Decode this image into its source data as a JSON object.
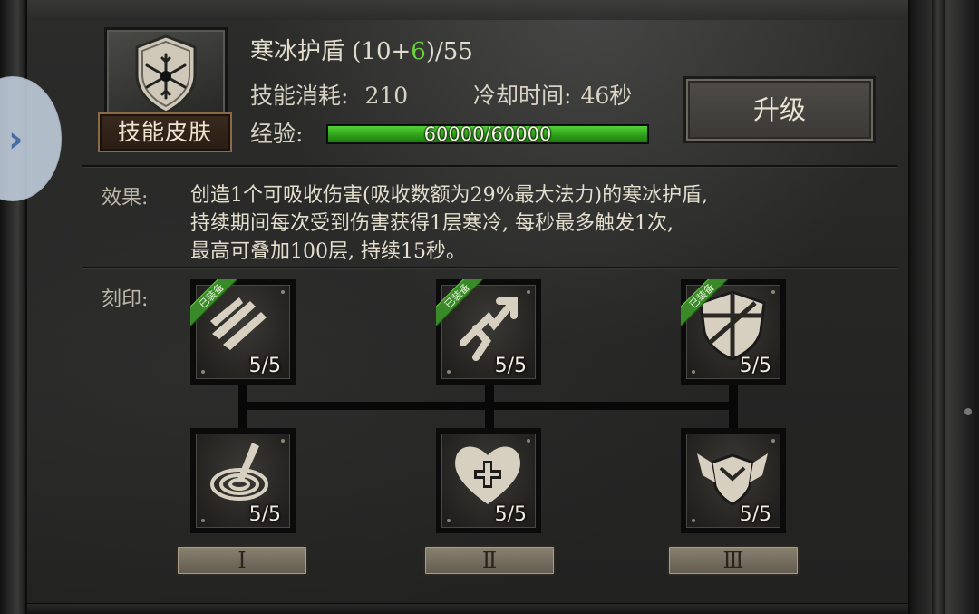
{
  "skill": {
    "name": "寒冰护盾",
    "level_prefix": "(10+",
    "level_bonus": "6",
    "level_suffix": ")/55",
    "skin_button": "技能皮肤",
    "cost_label": "技能消耗:",
    "cost_value": "210",
    "cooldown_label": "冷却时间:",
    "cooldown_value": "46秒",
    "exp_label": "经验:",
    "exp_text": "60000/60000",
    "exp_fraction": 1.0,
    "upgrade_button": "升级",
    "icon": "snowflake-shield-icon"
  },
  "effect": {
    "label": "效果:",
    "lines": [
      "创造1个可吸收伤害(吸收数额为29%最大法力)的寒冰护盾,",
      "持续期间每次受到伤害获得1层寒冷, 每秒最多触发1次,",
      "最高可叠加100层, 持续15秒。"
    ]
  },
  "runes": {
    "label": "刻印:",
    "equipped_tag": "已装备",
    "top": [
      {
        "level": "5/5",
        "equipped": true,
        "icon": "claw-slash-icon"
      },
      {
        "level": "5/5",
        "equipped": true,
        "icon": "upward-arrow-icon"
      },
      {
        "level": "5/5",
        "equipped": true,
        "icon": "cracked-shield-icon"
      }
    ],
    "bottom": [
      {
        "level": "5/5",
        "icon": "vortex-icon"
      },
      {
        "level": "5/5",
        "icon": "heart-plus-icon"
      },
      {
        "level": "5/5",
        "icon": "winged-shield-icon"
      }
    ],
    "tiers": [
      "Ⅰ",
      "Ⅱ",
      "Ⅲ"
    ]
  },
  "side_tab": {
    "icon": "chevron-right-icon",
    "glyph": "›"
  },
  "colors": {
    "exp_green": "#3fb826",
    "level_bonus_green": "#6ad23a",
    "equipped_green": "#3b8a2a",
    "skin_border": "#8c6a45"
  }
}
